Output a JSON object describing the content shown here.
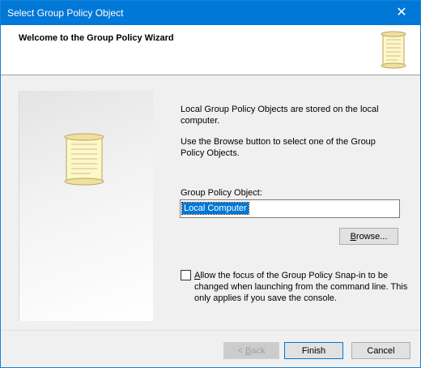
{
  "window": {
    "title": "Select Group Policy Object"
  },
  "header": {
    "heading": "Welcome to the Group Policy Wizard"
  },
  "icons": {
    "header": "scroll-icon",
    "side": "scroll-icon"
  },
  "main": {
    "paragraph1": "Local Group Policy Objects are stored on the local computer.",
    "paragraph2": "Use the Browse button to select one of the Group Policy Objects.",
    "gpo_label": "Group Policy Object:",
    "gpo_value": "Local Computer",
    "browse_label_prefix": "B",
    "browse_label_rest": "rowse...",
    "checkbox_label_prefix": "A",
    "checkbox_label_rest": "llow the focus of the Group Policy Snap-in to be changed when launching from the command line.  This only applies if you save the console.",
    "checkbox_checked": false
  },
  "footer": {
    "back_prefix": "< ",
    "back_u": "B",
    "back_rest": "ack",
    "finish_label": "Finish",
    "cancel_label": "Cancel"
  },
  "colors": {
    "accent": "#0078d7"
  }
}
